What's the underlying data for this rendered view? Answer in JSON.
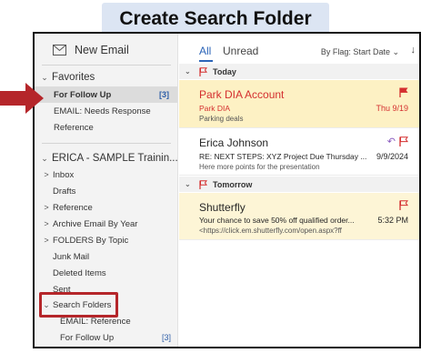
{
  "banner": {
    "title": "Create Search Folder"
  },
  "sidebar": {
    "new_email": "New Email",
    "favorites_label": "Favorites",
    "favorites": [
      {
        "label": "For Follow Up",
        "count": "[3]"
      },
      {
        "label": "EMAIL: Needs Response"
      },
      {
        "label": "Reference"
      }
    ],
    "account_label": "ERICA - SAMPLE Trainin...",
    "folders": [
      {
        "label": "Inbox",
        "chev": ">"
      },
      {
        "label": "Drafts",
        "chev": ""
      },
      {
        "label": "Reference",
        "chev": ">"
      },
      {
        "label": "Archive Email By Year",
        "chev": ">"
      },
      {
        "label": "FOLDERS By Topic",
        "chev": ">"
      },
      {
        "label": "Junk Mail",
        "chev": ""
      },
      {
        "label": "Deleted Items",
        "chev": ""
      },
      {
        "label": "Sent",
        "chev": ""
      },
      {
        "label": "Search Folders",
        "chev": "⌄"
      }
    ],
    "search_folders": [
      {
        "label": "EMAIL: Reference"
      },
      {
        "label": "For Follow Up",
        "count": "[3]"
      }
    ]
  },
  "main": {
    "tab_all": "All",
    "tab_unread": "Unread",
    "sort_label": "By Flag: Start Date  ⌄",
    "sort_arrow": "↓",
    "groups": {
      "today": "Today",
      "tomorrow": "Tomorrow"
    },
    "messages": [
      {
        "sender": "Park DIA Account",
        "subject": "Park DIA",
        "preview": "Parking deals",
        "date": "Thu 9/19"
      },
      {
        "sender": "Erica Johnson",
        "subject": "RE: NEXT STEPS:  XYZ Project Due Thursday ...",
        "preview": "Here more points for the presentation",
        "date": "9/9/2024"
      },
      {
        "sender": "Shutterfly",
        "subject": "Your chance to save 50% off qualified order...",
        "preview": "<https://click.em.shutterfly.com/open.aspx?ff",
        "date": "5:32 PM"
      }
    ]
  },
  "colors": {
    "accent": "#2c65b8",
    "flag": "#d42f2f",
    "annotation": "#b5262a",
    "banner_bg": "#dce5f3"
  }
}
